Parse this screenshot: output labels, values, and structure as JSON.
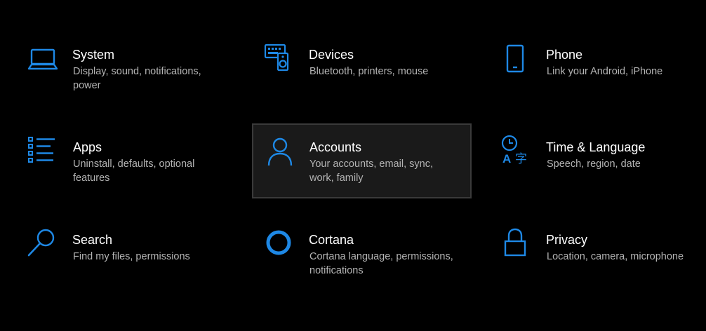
{
  "accent": "#1e88e5",
  "tiles": [
    {
      "id": "system",
      "icon": "laptop-icon",
      "title": "System",
      "line1": "Display, sound, notifications,",
      "line2": "power"
    },
    {
      "id": "devices",
      "icon": "keyboard-speaker-icon",
      "title": "Devices",
      "line1": "Bluetooth, printers, mouse",
      "line2": ""
    },
    {
      "id": "phone",
      "icon": "phone-icon",
      "title": "Phone",
      "line1": "Link your Android, iPhone",
      "line2": ""
    },
    {
      "id": "apps",
      "icon": "list-icon",
      "title": "Apps",
      "line1": "Uninstall, defaults, optional",
      "line2": "features"
    },
    {
      "id": "accounts",
      "icon": "person-icon",
      "title": "Accounts",
      "line1": "Your accounts, email, sync,",
      "line2": "work, family",
      "selected": true
    },
    {
      "id": "time-language",
      "icon": "clock-language-icon",
      "title": "Time & Language",
      "line1": "Speech, region, date",
      "line2": ""
    },
    {
      "id": "search",
      "icon": "search-icon",
      "title": "Search",
      "line1": "Find my files, permissions",
      "line2": ""
    },
    {
      "id": "cortana",
      "icon": "cortana-ring-icon",
      "title": "Cortana",
      "line1": "Cortana language, permissions,",
      "line2": "notifications"
    },
    {
      "id": "privacy",
      "icon": "lock-icon",
      "title": "Privacy",
      "line1": "Location, camera, microphone",
      "line2": ""
    }
  ]
}
